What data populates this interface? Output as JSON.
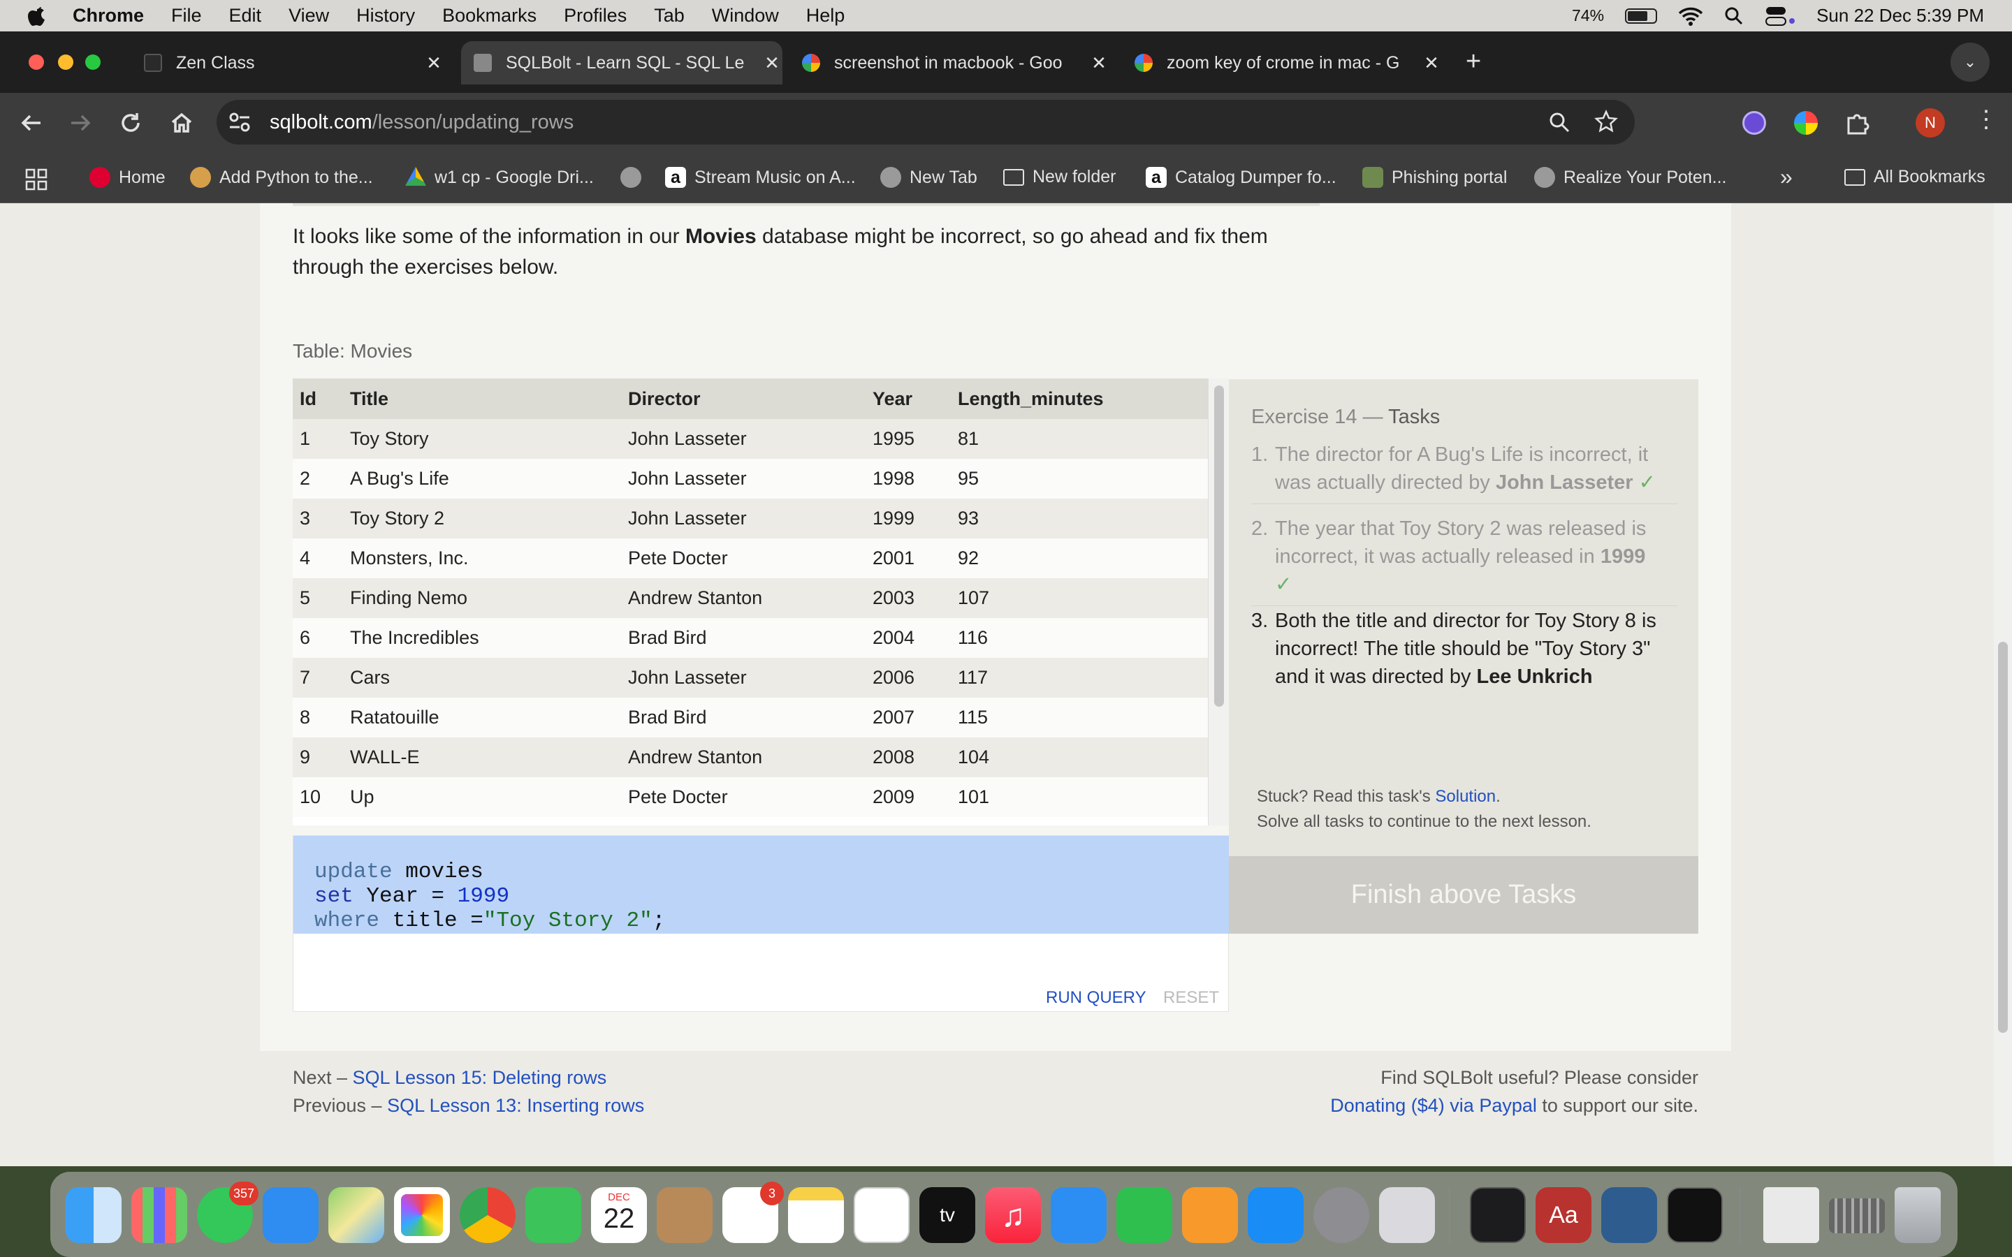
{
  "menubar": {
    "app_name": "Chrome",
    "items": [
      "File",
      "Edit",
      "View",
      "History",
      "Bookmarks",
      "Profiles",
      "Tab",
      "Window",
      "Help"
    ],
    "battery": "74%",
    "datetime": "Sun 22 Dec  5:39 PM"
  },
  "tabs": [
    {
      "title": "Zen Class"
    },
    {
      "title": "SQLBolt - Learn SQL - SQL Le"
    },
    {
      "title": "screenshot in macbook - Goo"
    },
    {
      "title": "zoom key of crome in mac - G"
    }
  ],
  "address": {
    "host": "sqlbolt.com",
    "path": "/lesson/updating_rows"
  },
  "profile_initial": "N",
  "bookmarks": [
    "Home",
    "Add Python to the...",
    "w1 cp - Google Dri...",
    "Stream Music on A...",
    "New Tab",
    "New folder",
    "Catalog Dumper fo...",
    "Phishing portal",
    "Realize Your Poten..."
  ],
  "bookmarks_all": "All Bookmarks",
  "intro": {
    "before": "It looks like some of the information in our ",
    "bold": "Movies",
    "after": " database might be incorrect, so go ahead and fix them through the exercises below."
  },
  "table_label": "Table: Movies",
  "table": {
    "headers": [
      "Id",
      "Title",
      "Director",
      "Year",
      "Length_minutes"
    ],
    "rows": [
      [
        "1",
        "Toy Story",
        "John Lasseter",
        "1995",
        "81"
      ],
      [
        "2",
        "A Bug's Life",
        "John Lasseter",
        "1998",
        "95"
      ],
      [
        "3",
        "Toy Story 2",
        "John Lasseter",
        "1999",
        "93"
      ],
      [
        "4",
        "Monsters, Inc.",
        "Pete Docter",
        "2001",
        "92"
      ],
      [
        "5",
        "Finding Nemo",
        "Andrew Stanton",
        "2003",
        "107"
      ],
      [
        "6",
        "The Incredibles",
        "Brad Bird",
        "2004",
        "116"
      ],
      [
        "7",
        "Cars",
        "John Lasseter",
        "2006",
        "117"
      ],
      [
        "8",
        "Ratatouille",
        "Brad Bird",
        "2007",
        "115"
      ],
      [
        "9",
        "WALL-E",
        "Andrew Stanton",
        "2008",
        "104"
      ],
      [
        "10",
        "Up",
        "Pete Docter",
        "2009",
        "101"
      ]
    ]
  },
  "query": {
    "l1_kw": "update",
    "l1_rest": " movies",
    "l2_kw": "set",
    "l2_rest": " Year = ",
    "l2_num": "1999",
    "l3_kw": "where",
    "l3_rest": " title =",
    "l3_str": "\"Toy Story 2\"",
    "l3_end": ";"
  },
  "buttons": {
    "run": "RUN QUERY",
    "reset": "RESET",
    "finish": "Finish above Tasks"
  },
  "exercise": {
    "prefix": "Exercise 14 — ",
    "tasks_word": "Tasks",
    "tasks": [
      {
        "n": "1.",
        "a": "The director for A Bug's Life is incorrect, it was actually directed by ",
        "b": "John Lasseter",
        "c": "",
        "check": "✓"
      },
      {
        "n": "2.",
        "a": "The year that Toy Story 2 was released is incorrect, it was actually released in ",
        "b": "1999",
        "c": "",
        "check": "✓"
      },
      {
        "n": "3.",
        "a": "Both the title and director for Toy Story 8 is incorrect! The title should be \"Toy Story 3\" and it was directed by ",
        "b": "Lee Unkrich",
        "c": "",
        "check": ""
      }
    ],
    "stuck_before": "Stuck? Read this task's ",
    "stuck_link": "Solution",
    "stuck_after": ".",
    "solve_all": "Solve all tasks to continue to the next lesson."
  },
  "footer": {
    "next_prefix": "Next – ",
    "next_link": "SQL Lesson 15: Deleting rows",
    "prev_prefix": "Previous – ",
    "prev_link": "SQL Lesson 13: Inserting rows",
    "useful": "Find SQLBolt useful? Please consider",
    "donate_link": "Donating ($4) via Paypal",
    "donate_after": " to support our site."
  },
  "dock": {
    "messages_badge": "357",
    "calendar_month": "DEC",
    "calendar_day": "22",
    "reminders_badge": "3",
    "dict_label": "Aa"
  },
  "colors": {
    "accent_link": "#2250c0",
    "selection": "#bcd4f8",
    "check": "#6cb26c"
  }
}
